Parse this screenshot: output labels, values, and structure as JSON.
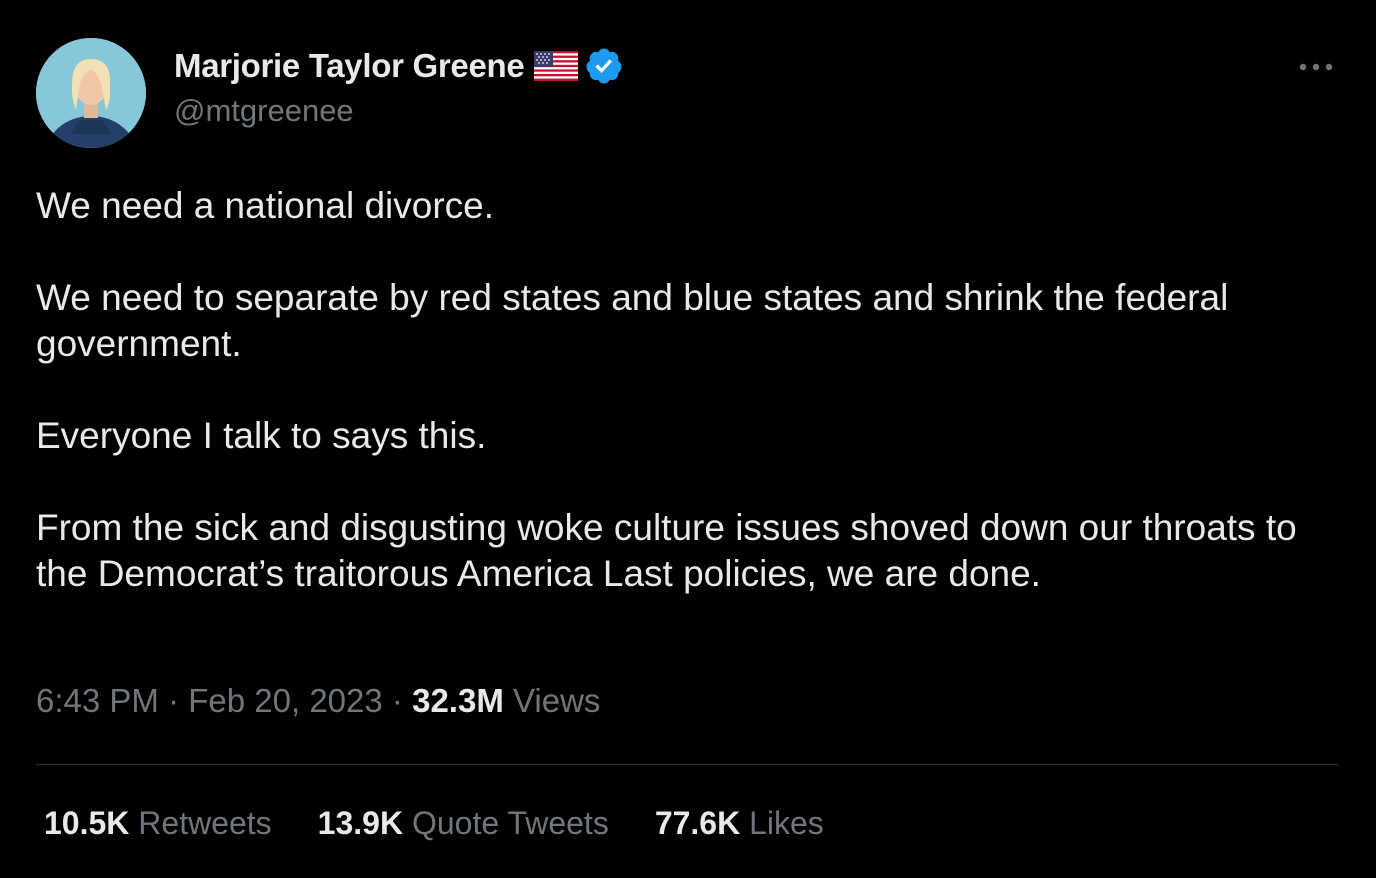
{
  "author": {
    "display_name": "Marjorie Taylor Greene",
    "handle": "@mtgreenee",
    "flag_icon": "us-flag-icon",
    "verified_icon": "verified-badge-icon",
    "verified_color": "#1d9bf0"
  },
  "menu": {
    "icon": "more-horizontal-icon"
  },
  "tweet": {
    "paragraphs": [
      "We need a national divorce.",
      "We need to separate by red states and blue states and shrink the federal government.",
      "Everyone I talk to says this.",
      "From the sick and disgusting woke culture issues shoved down our throats to the Democrat’s traitorous America Last policies, we are done."
    ]
  },
  "meta": {
    "time": "6:43 PM",
    "separator": "·",
    "date": "Feb 20, 2023",
    "views_count": "32.3M",
    "views_label": "Views"
  },
  "stats": {
    "retweets": {
      "count": "10.5K",
      "label": "Retweets"
    },
    "quote_tweets": {
      "count": "13.9K",
      "label": "Quote Tweets"
    },
    "likes": {
      "count": "77.6K",
      "label": "Likes"
    }
  },
  "colors": {
    "background": "#000000",
    "primary_text": "#e7e9ea",
    "secondary_text": "#71767b",
    "divider": "#2f3336",
    "accent": "#1d9bf0"
  }
}
